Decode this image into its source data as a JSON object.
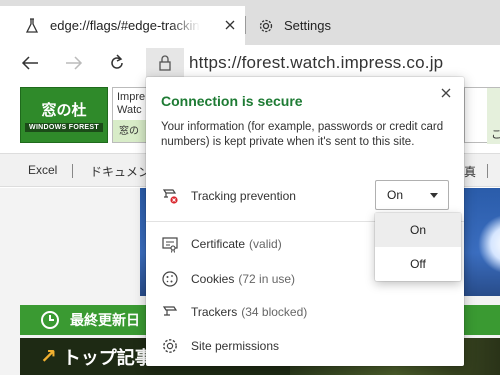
{
  "tabs": [
    {
      "title": "edge://flags/#edge-tracking-prevention",
      "icon": "flask-icon",
      "active": true
    },
    {
      "title": "Settings",
      "icon": "gear-icon",
      "active": false
    }
  ],
  "toolbar": {
    "url": "https://forest.watch.impress.co.jp"
  },
  "page": {
    "logo_jp": "窓の杜",
    "logo_en": "WINDOWS FOREST",
    "impress_text_1": "Impre",
    "impress_text_2": "Watc",
    "impress_band": "窓の",
    "right_box_text": "こ",
    "menu": [
      "Excel",
      "ドキュメン",
      "真"
    ],
    "green_bar_text": "最終更新日",
    "top_bar_text": "トップ記事"
  },
  "flyout": {
    "title": "Connection is secure",
    "description": "Your information (for example, passwords or credit card numbers) is kept private when it's sent to this site.",
    "tracking_label": "Tracking prevention",
    "tracking_value": "On",
    "items": [
      {
        "label": "Certificate",
        "detail": "(valid)",
        "icon": "certificate-icon"
      },
      {
        "label": "Cookies",
        "detail": "(72 in use)",
        "icon": "cookie-icon"
      },
      {
        "label": "Trackers",
        "detail": "(34 blocked)",
        "icon": "trackers-icon"
      },
      {
        "label": "Site permissions",
        "detail": "",
        "icon": "gear-icon"
      }
    ]
  },
  "dropdown": {
    "options": [
      "On",
      "Off"
    ],
    "selected": "On"
  },
  "colors": {
    "secure_green": "#1e7b34",
    "site_green": "#3a9a32",
    "tab_strip": "#dedede"
  }
}
